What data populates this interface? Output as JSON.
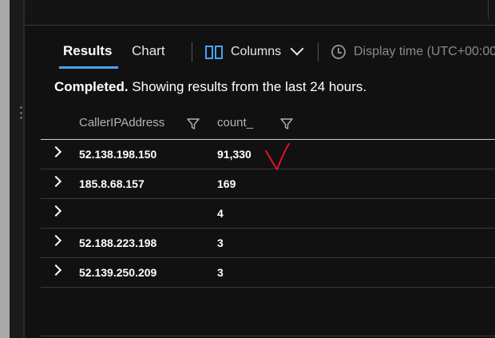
{
  "tabs": [
    {
      "label": "Results",
      "active": true
    },
    {
      "label": "Chart",
      "active": false
    }
  ],
  "toolbar": {
    "columns_label": "Columns",
    "display_time_label": "Display time (UTC+00:00"
  },
  "status": {
    "strong": "Completed.",
    "message": " Showing results from the last 24 hours."
  },
  "table": {
    "columns": [
      "CallerIPAddress",
      "count_"
    ],
    "rows": [
      {
        "ip": "52.138.198.150",
        "count": "91,330"
      },
      {
        "ip": "185.8.68.157",
        "count": "169"
      },
      {
        "ip": "",
        "count": "4"
      },
      {
        "ip": "52.188.223.198",
        "count": "3"
      },
      {
        "ip": "52.139.250.209",
        "count": "3"
      }
    ]
  },
  "colors": {
    "accent": "#4aa3f5",
    "background": "#111111",
    "annotation": "#e8102a"
  },
  "icons": [
    "columns-icon",
    "chevron-down-icon",
    "clock-icon",
    "filter-icon",
    "expand-chevron-icon"
  ]
}
